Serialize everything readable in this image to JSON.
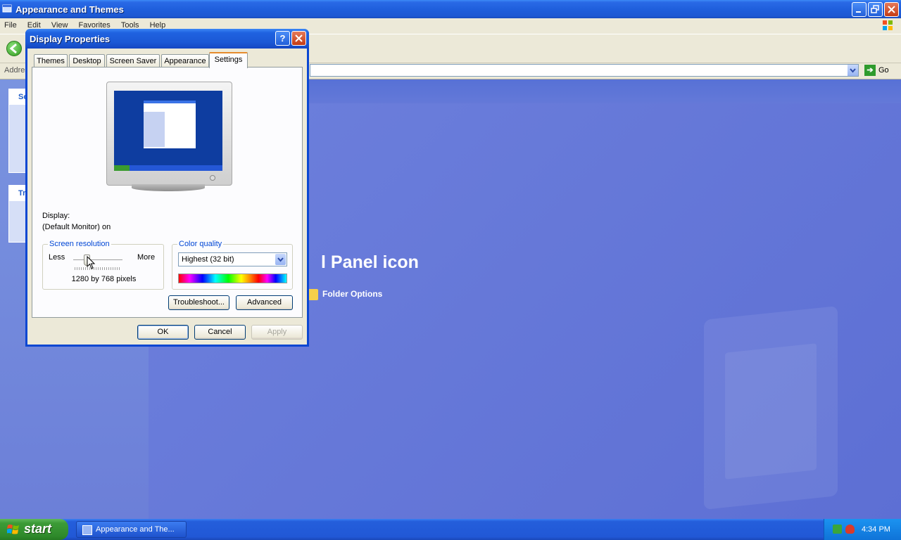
{
  "explorer": {
    "title": "Appearance and Themes",
    "menu": [
      "File",
      "Edit",
      "View",
      "Favorites",
      "Tools",
      "Help"
    ],
    "address_label": "Address",
    "go_label": "Go",
    "taskpane_heads": [
      "Se",
      "Tr"
    ],
    "pick_heading": "l Panel icon",
    "folder_options": "Folder Options"
  },
  "dialog": {
    "title": "Display Properties",
    "help_label": "?",
    "tabs": [
      "Themes",
      "Desktop",
      "Screen Saver",
      "Appearance",
      "Settings"
    ],
    "active_tab": "Settings",
    "display_label": "Display:",
    "display_value": "(Default Monitor) on",
    "resolution": {
      "title": "Screen resolution",
      "less": "Less",
      "more": "More",
      "value_text": "1280 by 768 pixels",
      "slider_level": 0.28
    },
    "color_quality": {
      "title": "Color quality",
      "selected": "Highest (32 bit)"
    },
    "buttons": {
      "troubleshoot": "Troubleshoot...",
      "advanced": "Advanced",
      "ok": "OK",
      "cancel": "Cancel",
      "apply": "Apply"
    }
  },
  "taskbar": {
    "start_label": "start",
    "task_label": "Appearance and The...",
    "clock": "4:34 PM"
  },
  "colors": {
    "xp_blue": "#245edb",
    "start_green": "#3c9b37",
    "dialog_face": "#ece9d8",
    "tab_accent": "#e68b2c"
  }
}
